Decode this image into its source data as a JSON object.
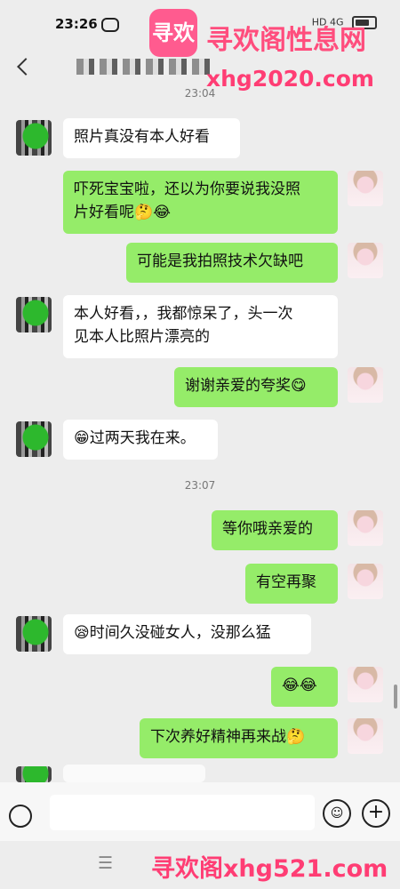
{
  "status": {
    "time": "23:26",
    "right_text": "HD 4G"
  },
  "header": {
    "title_blurred": true
  },
  "watermark_top": {
    "logo_text": "寻欢",
    "title": "寻欢阁性息网",
    "url": "xhg2020.com"
  },
  "chat": {
    "timestamps": [
      "23:04",
      "23:07"
    ],
    "messages": [
      {
        "side": "left",
        "text": "照片真没有本人好看"
      },
      {
        "side": "right",
        "text": "吓死宝宝啦，还以为你要说我没照\n片好看呢🤔😂"
      },
      {
        "side": "right",
        "text": "可能是我拍照技术欠缺吧"
      },
      {
        "side": "left",
        "text": "本人好看，，我都惊呆了，头一次\n见本人比照片漂亮的"
      },
      {
        "side": "right",
        "text": "谢谢亲爱的夸奖😋"
      },
      {
        "side": "left",
        "text": "😁过两天我在来。"
      },
      {
        "side": "right",
        "text": "等你哦亲爱的"
      },
      {
        "side": "right",
        "text": "有空再聚"
      },
      {
        "side": "left",
        "text": "😪时间久没碰女人，没那么猛"
      },
      {
        "side": "right",
        "text": "😂😂"
      },
      {
        "side": "right",
        "text": "下次养好精神再来战🤔"
      }
    ]
  },
  "input_bar": {
    "placeholder": "",
    "icons": [
      "voice-icon",
      "emoji-icon",
      "plus-icon"
    ]
  },
  "bottom": {
    "menu_icon": "☰",
    "watermark": "寻欢阁xhg521.com"
  }
}
